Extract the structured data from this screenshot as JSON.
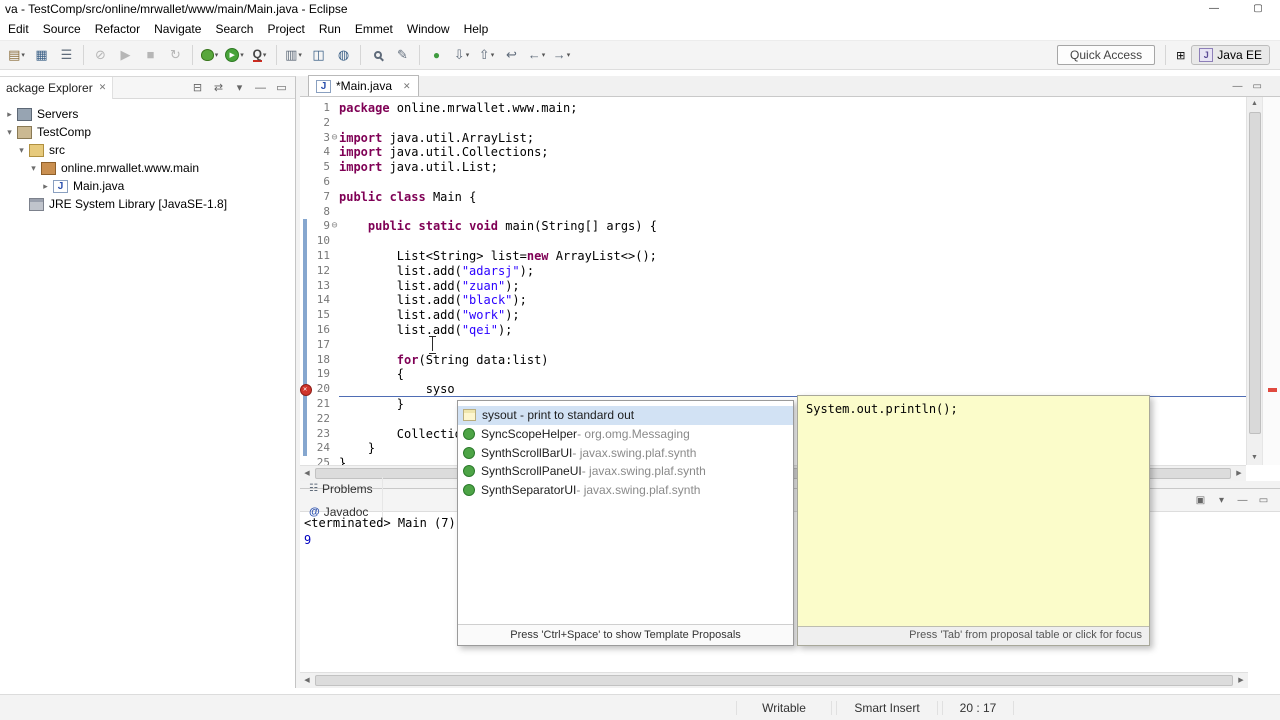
{
  "window": {
    "title": "va - TestComp/src/online/mrwallet/www/main/Main.java - Eclipse",
    "buttons": [
      {
        "name": "minimize-button",
        "glyph": "—"
      },
      {
        "name": "maximize-button",
        "glyph": "▢"
      }
    ]
  },
  "menubar": [
    "Edit",
    "Source",
    "Refactor",
    "Navigate",
    "Search",
    "Project",
    "Run",
    "Emmet",
    "Window",
    "Help"
  ],
  "toolbar": {
    "quick_access": "Quick Access",
    "perspective": "Java EE",
    "right_icons": [
      {
        "name": "open-perspective-icon",
        "glyph": "⊞"
      }
    ],
    "icons": [
      {
        "name": "new-wizard-icon",
        "glyph": "▤",
        "style": "tan",
        "caret": true
      },
      {
        "name": "save-icon",
        "glyph": "▦",
        "style": "blue"
      },
      {
        "name": "print-icon",
        "glyph": "☰",
        "style": "plain"
      },
      {
        "sep": true
      },
      {
        "name": "skip-breakpoints-icon",
        "glyph": "⊘",
        "style": "disabled"
      },
      {
        "name": "start-server-icon",
        "glyph": "▶",
        "style": "disabled"
      },
      {
        "name": "stop-server-icon",
        "glyph": "■",
        "style": "disabled"
      },
      {
        "name": "restart-server-icon",
        "glyph": "↻",
        "style": "disabled"
      },
      {
        "sep": true
      },
      {
        "name": "debug-icon",
        "glyph": "",
        "style": "bug",
        "caret": true
      },
      {
        "name": "run-icon",
        "glyph": "▶",
        "style": "runcircle",
        "caret": true
      },
      {
        "name": "external-tools-icon",
        "glyph": "Q",
        "style": "qred",
        "caret": true
      },
      {
        "sep": true
      },
      {
        "name": "coverage-icon",
        "glyph": "▥",
        "style": "plain",
        "caret": true
      },
      {
        "name": "new-servlet-icon",
        "glyph": "◫",
        "style": "blue"
      },
      {
        "name": "web-browser-icon",
        "glyph": "◍",
        "style": "blue"
      },
      {
        "sep": true
      },
      {
        "name": "search-icon",
        "glyph": "",
        "style": "mag"
      },
      {
        "name": "mark-occurrences-icon",
        "glyph": "✎",
        "style": "plain"
      },
      {
        "sep": true
      },
      {
        "name": "record-icon",
        "glyph": "●",
        "style": "green"
      },
      {
        "name": "next-annotation-icon",
        "glyph": "⇩",
        "style": "plain",
        "caret": true
      },
      {
        "name": "previous-annotation-icon",
        "glyph": "⇧",
        "style": "plain",
        "caret": true
      },
      {
        "name": "last-edit-location-icon",
        "glyph": "↩",
        "style": "plain"
      },
      {
        "name": "back-icon",
        "glyph": "←",
        "style": "plain",
        "caret": true
      },
      {
        "name": "forward-icon",
        "glyph": "→",
        "style": "plain",
        "caret": true
      }
    ]
  },
  "package_explorer": {
    "title": "ackage Explorer",
    "close_glyph": "✕",
    "header_icons": [
      {
        "name": "collapse-all-icon",
        "glyph": "⊟"
      },
      {
        "name": "link-with-editor-icon",
        "glyph": "⇄"
      },
      {
        "name": "view-menu-icon",
        "glyph": "▾"
      },
      {
        "name": "minimize-view-icon",
        "glyph": "—"
      },
      {
        "name": "maximize-view-icon",
        "glyph": "▭"
      }
    ],
    "tree": [
      {
        "label": "Servers",
        "indent": 0,
        "arrow": "▸",
        "icon": "servers"
      },
      {
        "label": "TestComp",
        "indent": 0,
        "arrow": "▾",
        "icon": "project"
      },
      {
        "label": "src",
        "indent": 1,
        "arrow": "▾",
        "icon": "src-folder"
      },
      {
        "label": "online.mrwallet.www.main",
        "indent": 2,
        "arrow": "▾",
        "icon": "package"
      },
      {
        "label": "Main.java",
        "indent": 3,
        "arrow": "▸",
        "icon": "java-file"
      },
      {
        "label": "JRE System Library [JavaSE-1.8]",
        "indent": 1,
        "arrow": "",
        "icon": "library"
      }
    ]
  },
  "editor": {
    "tab": "*Main.java",
    "tab_close_glyph": "✕",
    "tabbar_icons": [
      {
        "name": "minimize-view-icon",
        "glyph": "—"
      },
      {
        "name": "maximize-view-icon",
        "glyph": "▭"
      }
    ],
    "range_bar": {
      "from": 9,
      "to": 24
    },
    "lines": [
      {
        "n": 1,
        "seg": [
          [
            "k",
            "package"
          ],
          [
            "p",
            " online.mrwallet.www.main;"
          ]
        ]
      },
      {
        "n": 2,
        "seg": []
      },
      {
        "n": 3,
        "fold": true,
        "seg": [
          [
            "k",
            "import"
          ],
          [
            "p",
            " java.util.ArrayList;"
          ]
        ]
      },
      {
        "n": 4,
        "seg": [
          [
            "k",
            "import"
          ],
          [
            "p",
            " java.util.Collections;"
          ]
        ]
      },
      {
        "n": 5,
        "seg": [
          [
            "k",
            "import"
          ],
          [
            "p",
            " java.util.List;"
          ]
        ]
      },
      {
        "n": 6,
        "seg": []
      },
      {
        "n": 7,
        "seg": [
          [
            "k",
            "public"
          ],
          [
            "p",
            " "
          ],
          [
            "k",
            "class"
          ],
          [
            "p",
            " Main {"
          ]
        ]
      },
      {
        "n": 8,
        "seg": []
      },
      {
        "n": 9,
        "fold": true,
        "seg": [
          [
            "p",
            "    "
          ],
          [
            "k",
            "public"
          ],
          [
            "p",
            " "
          ],
          [
            "k",
            "static"
          ],
          [
            "p",
            " "
          ],
          [
            "k",
            "void"
          ],
          [
            "p",
            " main(String[] args) {"
          ]
        ]
      },
      {
        "n": 10,
        "seg": []
      },
      {
        "n": 11,
        "seg": [
          [
            "p",
            "        List<String> list="
          ],
          [
            "k",
            "new"
          ],
          [
            "p",
            " ArrayList<>();"
          ]
        ]
      },
      {
        "n": 12,
        "seg": [
          [
            "p",
            "        list.add("
          ],
          [
            "s",
            "\"adarsj\""
          ],
          [
            "p",
            ");"
          ]
        ]
      },
      {
        "n": 13,
        "seg": [
          [
            "p",
            "        list.add("
          ],
          [
            "s",
            "\"zuan\""
          ],
          [
            "p",
            ");"
          ]
        ]
      },
      {
        "n": 14,
        "seg": [
          [
            "p",
            "        list.add("
          ],
          [
            "s",
            "\"black\""
          ],
          [
            "p",
            ");"
          ]
        ]
      },
      {
        "n": 15,
        "seg": [
          [
            "p",
            "        list.add("
          ],
          [
            "s",
            "\"work\""
          ],
          [
            "p",
            ");"
          ]
        ]
      },
      {
        "n": 16,
        "seg": [
          [
            "p",
            "        list.add("
          ],
          [
            "s",
            "\"qei\""
          ],
          [
            "p",
            ");"
          ]
        ]
      },
      {
        "n": 17,
        "seg": []
      },
      {
        "n": 18,
        "seg": [
          [
            "p",
            "        "
          ],
          [
            "k",
            "for"
          ],
          [
            "p",
            "(String data:list)"
          ]
        ]
      },
      {
        "n": 19,
        "seg": [
          [
            "p",
            "        {"
          ]
        ]
      },
      {
        "n": 20,
        "error": true,
        "current": true,
        "seg": [
          [
            "p",
            "            syso"
          ]
        ]
      },
      {
        "n": 21,
        "seg": [
          [
            "p",
            "        }"
          ]
        ]
      },
      {
        "n": 22,
        "seg": []
      },
      {
        "n": 23,
        "seg": [
          [
            "p",
            "        Collectio"
          ]
        ]
      },
      {
        "n": 24,
        "seg": [
          [
            "p",
            "    }"
          ]
        ]
      },
      {
        "n": 25,
        "seg": [
          [
            "p",
            "}"
          ]
        ]
      }
    ]
  },
  "autocomplete": {
    "items": [
      {
        "icon": "template",
        "label": "sysout - print to standard out",
        "selected": true
      },
      {
        "icon": "class",
        "name": "SyncScopeHelper",
        "pkg": " - org.omg.Messaging"
      },
      {
        "icon": "class",
        "name": "SynthScrollBarUI",
        "pkg": " - javax.swing.plaf.synth"
      },
      {
        "icon": "class",
        "name": "SynthScrollPaneUI",
        "pkg": " - javax.swing.plaf.synth"
      },
      {
        "icon": "class",
        "name": "SynthSeparatorUI",
        "pkg": " - javax.swing.plaf.synth"
      }
    ],
    "footer": "Press 'Ctrl+Space' to show Template Proposals"
  },
  "proposal_preview": {
    "code": "System.out.println();",
    "footer": "Press 'Tab' from proposal table or click for focus"
  },
  "console": {
    "tabs": [
      {
        "label": "Problems",
        "icon": "problems-icon",
        "glyph": "☷"
      },
      {
        "label": "Javadoc",
        "icon": "javadoc-icon",
        "glyph": "@"
      }
    ],
    "toolbar_icons": [
      {
        "name": "pin-console-icon",
        "glyph": "▣"
      },
      {
        "name": "view-menu-icon",
        "glyph": "▾"
      },
      {
        "name": "minimize-view-icon",
        "glyph": "—"
      },
      {
        "name": "maximize-view-icon",
        "glyph": "▭"
      }
    ],
    "status_line": "<terminated> Main (7) [Java A",
    "output": "9"
  },
  "statusbar": {
    "writable": "Writable",
    "insert_mode": "Smart Insert",
    "position": "20 : 17"
  }
}
